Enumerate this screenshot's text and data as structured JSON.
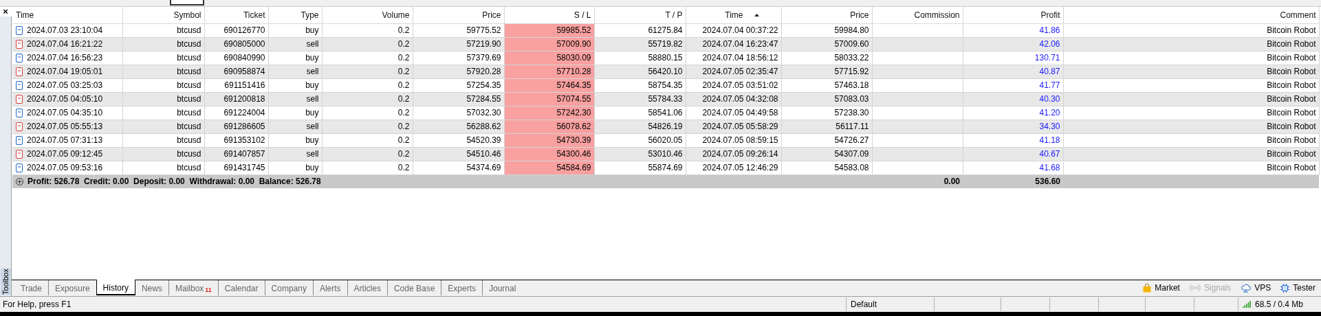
{
  "toolbox": {
    "close": "×",
    "label": "Toolbox"
  },
  "table": {
    "columns": [
      {
        "label": "Time",
        "kind": "time",
        "highlighted": false,
        "sorted": false
      },
      {
        "label": "Symbol",
        "kind": "text",
        "highlighted": false,
        "sorted": false
      },
      {
        "label": "Ticket",
        "kind": "text",
        "highlighted": false,
        "sorted": false
      },
      {
        "label": "Type",
        "kind": "text",
        "highlighted": false,
        "sorted": false
      },
      {
        "label": "Volume",
        "kind": "text",
        "highlighted": false,
        "sorted": false
      },
      {
        "label": "Price",
        "kind": "text",
        "highlighted": false,
        "sorted": false
      },
      {
        "label": "S / L",
        "kind": "text",
        "highlighted": true,
        "sorted": false
      },
      {
        "label": "T / P",
        "kind": "text",
        "highlighted": false,
        "sorted": false
      },
      {
        "label": "Time",
        "kind": "text",
        "highlighted": false,
        "sorted": true
      },
      {
        "label": "Price",
        "kind": "text",
        "highlighted": false,
        "sorted": false
      },
      {
        "label": "Commission",
        "kind": "text",
        "highlighted": false,
        "sorted": false
      },
      {
        "label": "Profit",
        "kind": "profit",
        "highlighted": false,
        "sorted": false
      },
      {
        "label": "Comment",
        "kind": "text",
        "highlighted": false,
        "sorted": false
      }
    ],
    "rows": [
      {
        "color": "#1d64c8",
        "cells": [
          "2024.07.03 23:10:04",
          "btcusd",
          "690126770",
          "buy",
          "0.2",
          "59775.52",
          "59985.52",
          "61275.84",
          "2024.07.04 00:37:22",
          "59984.80",
          null,
          "41.86",
          "Bitcoin Robot"
        ]
      },
      {
        "color": "#d83b3b",
        "cells": [
          "2024.07.04 16:21:22",
          "btcusd",
          "690805000",
          "sell",
          "0.2",
          "57219.90",
          "57009.90",
          "55719.82",
          "2024.07.04 16:23:47",
          "57009.60",
          null,
          "42.06",
          "Bitcoin Robot"
        ]
      },
      {
        "color": "#1d64c8",
        "cells": [
          "2024.07.04 16:56:23",
          "btcusd",
          "690840990",
          "buy",
          "0.2",
          "57379.69",
          "58030.09",
          "58880.15",
          "2024.07.04 18:56:12",
          "58033.22",
          null,
          "130.71",
          "Bitcoin Robot"
        ]
      },
      {
        "color": "#d83b3b",
        "cells": [
          "2024.07.04 19:05:01",
          "btcusd",
          "690958874",
          "sell",
          "0.2",
          "57920.28",
          "57710.28",
          "56420.10",
          "2024.07.05 02:35:47",
          "57715.92",
          null,
          "40.87",
          "Bitcoin Robot"
        ]
      },
      {
        "color": "#1d64c8",
        "cells": [
          "2024.07.05 03:25:03",
          "btcusd",
          "691151416",
          "buy",
          "0.2",
          "57254.35",
          "57464.35",
          "58754.35",
          "2024.07.05 03:51:02",
          "57463.18",
          null,
          "41.77",
          "Bitcoin Robot"
        ]
      },
      {
        "color": "#d83b3b",
        "cells": [
          "2024.07.05 04:05:10",
          "btcusd",
          "691200818",
          "sell",
          "0.2",
          "57284.55",
          "57074.55",
          "55784.33",
          "2024.07.05 04:32:08",
          "57083.03",
          null,
          "40.30",
          "Bitcoin Robot"
        ]
      },
      {
        "color": "#1d64c8",
        "cells": [
          "2024.07.05 04:35:10",
          "btcusd",
          "691224004",
          "buy",
          "0.2",
          "57032.30",
          "57242.30",
          "58541.06",
          "2024.07.05 04:49:58",
          "57238.30",
          null,
          "41.20",
          "Bitcoin Robot"
        ]
      },
      {
        "color": "#d83b3b",
        "cells": [
          "2024.07.05 05:55:13",
          "btcusd",
          "691286605",
          "sell",
          "0.2",
          "56288.62",
          "56078.62",
          "54826.19",
          "2024.07.05 05:58:29",
          "56117.11",
          null,
          "34.30",
          "Bitcoin Robot"
        ]
      },
      {
        "color": "#1d64c8",
        "cells": [
          "2024.07.05 07:31:13",
          "btcusd",
          "691353102",
          "buy",
          "0.2",
          "54520.39",
          "54730.39",
          "56020.05",
          "2024.07.05 08:59:15",
          "54726.27",
          null,
          "41.18",
          "Bitcoin Robot"
        ]
      },
      {
        "color": "#d83b3b",
        "cells": [
          "2024.07.05 09:12:45",
          "btcusd",
          "691407857",
          "sell",
          "0.2",
          "54510.46",
          "54300.46",
          "53010.46",
          "2024.07.05 09:26:14",
          "54307.09",
          null,
          "40.67",
          "Bitcoin Robot"
        ]
      },
      {
        "color": "#1d64c8",
        "cells": [
          "2024.07.05 09:53:16",
          "btcusd",
          "691431745",
          "buy",
          "0.2",
          "54374.69",
          "54584.69",
          "55874.69",
          "2024.07.05 12:46:29",
          "54583.08",
          null,
          "41.68",
          "Bitcoin Robot"
        ]
      }
    ],
    "summary": {
      "text": "Profit: 526.78  Credit: 0.00  Deposit: 0.00  Withdrawal: 0.00  Balance: 526.78",
      "commission": "0.00",
      "profit": "536.60"
    }
  },
  "tabs": [
    {
      "label": "Trade",
      "selected": false
    },
    {
      "label": "Exposure",
      "selected": false
    },
    {
      "label": "History",
      "selected": true
    },
    {
      "label": "News",
      "selected": false
    },
    {
      "label": "Mailbox",
      "selected": false,
      "badge": "11"
    },
    {
      "label": "Calendar",
      "selected": false
    },
    {
      "label": "Company",
      "selected": false
    },
    {
      "label": "Alerts",
      "selected": false
    },
    {
      "label": "Articles",
      "selected": false
    },
    {
      "label": "Code Base",
      "selected": false
    },
    {
      "label": "Experts",
      "selected": false
    },
    {
      "label": "Journal",
      "selected": false
    }
  ],
  "tools": [
    {
      "kind": "market",
      "label": "Market",
      "disabled": false
    },
    {
      "kind": "signals",
      "label": "Signals",
      "disabled": true
    },
    {
      "kind": "vps",
      "label": "VPS",
      "disabled": false
    },
    {
      "kind": "tester",
      "label": "Tester",
      "disabled": false
    }
  ],
  "status_bar": {
    "help": "For Help, press F1",
    "profile": "Default",
    "connection": "68.5 / 0.4 Mb"
  }
}
